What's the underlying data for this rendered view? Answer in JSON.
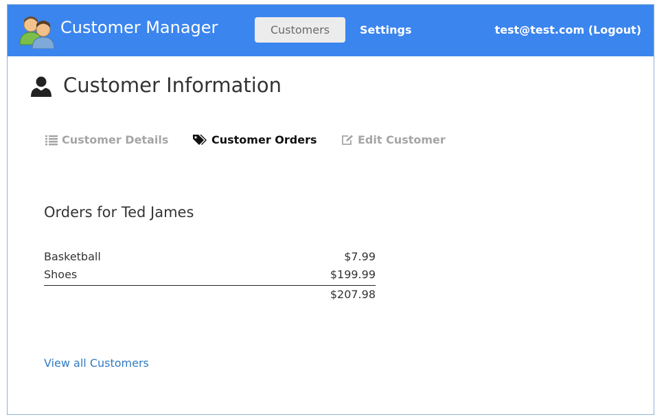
{
  "navbar": {
    "brand": "Customer Manager",
    "customers_label": "Customers",
    "settings_label": "Settings",
    "user_label": "test@test.com (Logout)",
    "background_color": "#3b85ee"
  },
  "page": {
    "title": "Customer Information",
    "title_icon": "person-icon"
  },
  "tabs": [
    {
      "label": "Customer Details",
      "icon": "list-icon",
      "active": false
    },
    {
      "label": "Customer Orders",
      "icon": "tags-icon",
      "active": true
    },
    {
      "label": "Edit Customer",
      "icon": "edit-icon",
      "active": false
    }
  ],
  "orders": {
    "heading": "Orders for Ted James",
    "items": [
      {
        "product": "Basketball",
        "price": "$7.99"
      },
      {
        "product": "Shoes",
        "price": "$199.99"
      }
    ],
    "total": "$207.98"
  },
  "footer_link": "View all Customers",
  "colors": {
    "link": "#2f7ac2",
    "inactive_tab": "#a5a5a5",
    "active_tab": "#111111"
  }
}
